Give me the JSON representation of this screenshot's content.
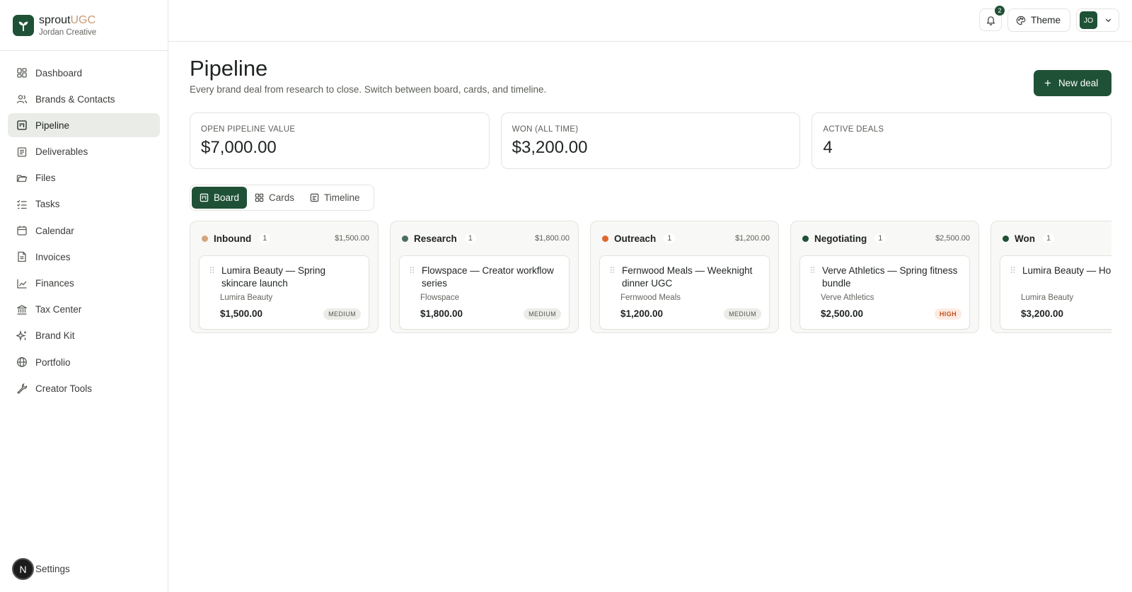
{
  "brand": {
    "name_main": "sprout",
    "name_accent": "UGC",
    "subtitle": "Jordan Creative",
    "logo_icon": "sprout-icon"
  },
  "sidebar": {
    "items": [
      {
        "label": "Dashboard",
        "icon": "dashboard-icon",
        "active": false
      },
      {
        "label": "Brands & Contacts",
        "icon": "users-icon",
        "active": false
      },
      {
        "label": "Pipeline",
        "icon": "kanban-icon",
        "active": true
      },
      {
        "label": "Deliverables",
        "icon": "document-list-icon",
        "active": false
      },
      {
        "label": "Files",
        "icon": "folder-icon",
        "active": false
      },
      {
        "label": "Tasks",
        "icon": "checklist-icon",
        "active": false
      },
      {
        "label": "Calendar",
        "icon": "calendar-icon",
        "active": false
      },
      {
        "label": "Invoices",
        "icon": "invoice-icon",
        "active": false
      },
      {
        "label": "Finances",
        "icon": "line-chart-icon",
        "active": false
      },
      {
        "label": "Tax Center",
        "icon": "bank-icon",
        "active": false
      },
      {
        "label": "Brand Kit",
        "icon": "sparkles-icon",
        "active": false
      },
      {
        "label": "Portfolio",
        "icon": "globe-icon",
        "active": false
      },
      {
        "label": "Creator Tools",
        "icon": "wrench-icon",
        "active": false
      }
    ],
    "settings": {
      "avatar_letter": "N",
      "label": "Settings"
    }
  },
  "topbar": {
    "notification_count": "2",
    "theme_label": "Theme",
    "user_initials": "JO"
  },
  "page": {
    "title": "Pipeline",
    "subtitle": "Every brand deal from research to close. Switch between board, cards, and timeline.",
    "new_deal_label": "New deal"
  },
  "stats": [
    {
      "label": "OPEN PIPELINE VALUE",
      "value": "$7,000.00"
    },
    {
      "label": "WON (ALL TIME)",
      "value": "$3,200.00"
    },
    {
      "label": "ACTIVE DEALS",
      "value": "4"
    }
  ],
  "view_tabs": [
    {
      "label": "Board",
      "icon": "board-icon",
      "active": true
    },
    {
      "label": "Cards",
      "icon": "grid-icon",
      "active": false
    },
    {
      "label": "Timeline",
      "icon": "timeline-icon",
      "active": false
    }
  ],
  "columns": [
    {
      "name": "Inbound",
      "count": "1",
      "total": "$1,500.00",
      "dot_color": "#d4a57c",
      "deals": [
        {
          "title": "Lumira Beauty — Spring skincare launch",
          "brand": "Lumira Beauty",
          "amount": "$1,500.00",
          "priority": "MEDIUM"
        }
      ]
    },
    {
      "name": "Research",
      "count": "1",
      "total": "$1,800.00",
      "dot_color": "#4c6e5e",
      "deals": [
        {
          "title": "Flowspace — Creator workflow series",
          "brand": "Flowspace",
          "amount": "$1,800.00",
          "priority": "MEDIUM"
        }
      ]
    },
    {
      "name": "Outreach",
      "count": "1",
      "total": "$1,200.00",
      "dot_color": "#e0672e",
      "deals": [
        {
          "title": "Fernwood Meals — Weeknight dinner UGC",
          "brand": "Fernwood Meals",
          "amount": "$1,200.00",
          "priority": "MEDIUM"
        }
      ]
    },
    {
      "name": "Negotiating",
      "count": "1",
      "total": "$2,500.00",
      "dot_color": "#1f5136",
      "deals": [
        {
          "title": "Verve Athletics — Spring fitness bundle",
          "brand": "Verve Athletics",
          "amount": "$2,500.00",
          "priority": "HIGH"
        }
      ]
    },
    {
      "name": "Won",
      "count": "1",
      "total": "",
      "dot_color": "#1f5136",
      "deals": [
        {
          "title": "Lumira Beauty — Ho GRWM",
          "brand": "Lumira Beauty",
          "amount": "$3,200.00",
          "priority": ""
        }
      ]
    }
  ],
  "colors": {
    "accent": "#1f5136",
    "brand_accent": "#c79a73",
    "high_priority": "#c4521c"
  }
}
